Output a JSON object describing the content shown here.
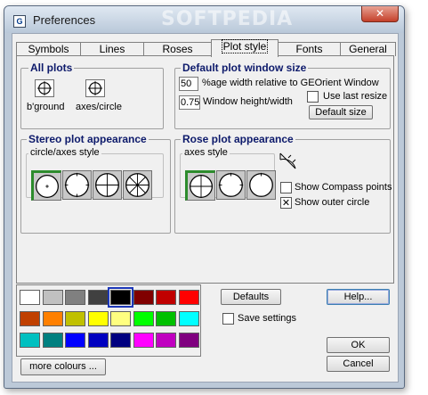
{
  "window": {
    "title": "Preferences",
    "watermark": "SOFTPEDIA",
    "close_glyph": "✕"
  },
  "tabs": [
    "Symbols",
    "Lines",
    "Roses",
    "Plot style",
    "Fonts",
    "General"
  ],
  "all_plots": {
    "title": "All plots",
    "bground_label": "b'ground",
    "axes_label": "axes/circle"
  },
  "default_size": {
    "title": "Default plot window size",
    "width_value": "50",
    "width_label": "%age width relative to GEOrient Window",
    "height_value": "0.75",
    "height_label": "Window height/width",
    "use_last_label": "Use last resize",
    "use_last_checked": false,
    "default_button": "Default size"
  },
  "stereo": {
    "title": "Stereo plot appearance",
    "style_label": "circle/axes style"
  },
  "rose": {
    "title": "Rose plot appearance",
    "style_label": "axes style",
    "compass_label": "Show Compass points",
    "compass_checked": false,
    "outer_label": "Show outer circle",
    "outer_checked": true
  },
  "palette": {
    "colors": [
      "#ffffff",
      "#c0c0c0",
      "#808080",
      "#404040",
      "#000000",
      "#800000",
      "#c00000",
      "#ff0000",
      "#c04000",
      "#ff8000",
      "#c0c000",
      "#ffff00",
      "#ffff80",
      "#00ff00",
      "#00c000",
      "#00ffff",
      "#00c0c0",
      "#008080",
      "#0000ff",
      "#0000c0",
      "#000080",
      "#ff00ff",
      "#c000c0",
      "#800080"
    ],
    "selected_index": 4
  },
  "buttons": {
    "defaults": "Defaults",
    "help": "Help...",
    "save_settings": "Save settings",
    "ok": "OK",
    "cancel": "Cancel",
    "more_colours": "more colours ..."
  }
}
